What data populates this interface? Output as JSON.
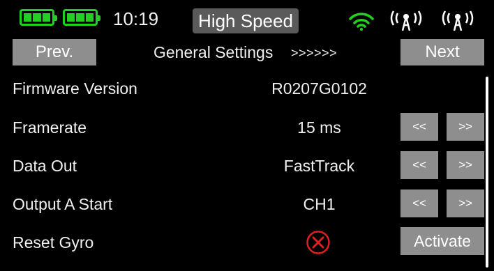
{
  "status_bar": {
    "time": "10:19",
    "mode": "High Speed",
    "battery_color": "#22d022",
    "wifi_color": "#22d022",
    "icons": [
      "battery-icon",
      "battery-icon",
      "wifi-icon",
      "antenna-icon",
      "antenna-icon"
    ]
  },
  "header": {
    "prev_label": "Prev.",
    "title": "General Settings",
    "page_indicator": ">>>>>>",
    "next_label": "Next"
  },
  "rows": [
    {
      "label": "Firmware Version",
      "value": "R0207G0102"
    },
    {
      "label": "Framerate",
      "value": "15 ms",
      "decrement_label": "<<",
      "increment_label": ">>"
    },
    {
      "label": "Data Out",
      "value": "FastTrack",
      "decrement_label": "<<",
      "increment_label": ">>"
    },
    {
      "label": "Output A Start",
      "value": "CH1",
      "decrement_label": "<<",
      "increment_label": ">>"
    },
    {
      "label": "Reset Gyro",
      "status_icon": "x-circle-icon",
      "status_color": "#e02020",
      "action_label": "Activate"
    }
  ],
  "colors": {
    "background": "#000000",
    "button": "#8e8e8e",
    "mode_badge": "#5a5a5a",
    "accent_green": "#22d022",
    "alert_red": "#e02020"
  }
}
